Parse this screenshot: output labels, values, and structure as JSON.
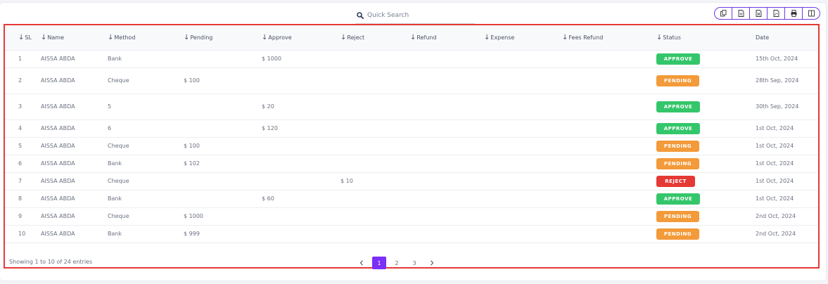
{
  "search": {
    "placeholder": "Quick Search"
  },
  "toolbar": {
    "buttons": [
      "copy-icon",
      "csv-icon",
      "excel-icon",
      "pdf-icon",
      "print-icon",
      "columns-icon"
    ]
  },
  "table": {
    "headers": {
      "sl": "SL",
      "name": "Name",
      "method": "Method",
      "pending": "Pending",
      "approve": "Approve",
      "reject": "Reject",
      "refund": "Refund",
      "expense": "Expense",
      "fees_refund": "Fees Refund",
      "status": "Status",
      "date": "Date"
    },
    "rows": [
      {
        "sl": "1",
        "name": "AISSA ABDA",
        "method": "Bank",
        "pending": "",
        "approve": "$ 1000",
        "reject": "",
        "refund": "",
        "expense": "",
        "fees_refund": "",
        "status": "APPROVE",
        "date": "15th Oct, 2024"
      },
      {
        "sl": "2",
        "name": "AISSA ABDA",
        "method": "Cheque",
        "pending": "$ 100",
        "approve": "",
        "reject": "",
        "refund": "",
        "expense": "",
        "fees_refund": "",
        "status": "PENDING",
        "date": "28th Sep, 2024"
      },
      {
        "sl": "3",
        "name": "AISSA ABDA",
        "method": "5",
        "pending": "",
        "approve": "$ 20",
        "reject": "",
        "refund": "",
        "expense": "",
        "fees_refund": "",
        "status": "APPROVE",
        "date": "30th Sep, 2024"
      },
      {
        "sl": "4",
        "name": "AISSA ABDA",
        "method": "6",
        "pending": "",
        "approve": "$ 120",
        "reject": "",
        "refund": "",
        "expense": "",
        "fees_refund": "",
        "status": "APPROVE",
        "date": "1st Oct, 2024"
      },
      {
        "sl": "5",
        "name": "AISSA ABDA",
        "method": "Cheque",
        "pending": "$ 100",
        "approve": "",
        "reject": "",
        "refund": "",
        "expense": "",
        "fees_refund": "",
        "status": "PENDING",
        "date": "1st Oct, 2024"
      },
      {
        "sl": "6",
        "name": "AISSA ABDA",
        "method": "Bank",
        "pending": "$ 102",
        "approve": "",
        "reject": "",
        "refund": "",
        "expense": "",
        "fees_refund": "",
        "status": "PENDING",
        "date": "1st Oct, 2024"
      },
      {
        "sl": "7",
        "name": "AISSA ABDA",
        "method": "Cheque",
        "pending": "",
        "approve": "",
        "reject": "$ 10",
        "refund": "",
        "expense": "",
        "fees_refund": "",
        "status": "REJECT",
        "date": "1st Oct, 2024"
      },
      {
        "sl": "8",
        "name": "AISSA ABDA",
        "method": "Bank",
        "pending": "",
        "approve": "$ 60",
        "reject": "",
        "refund": "",
        "expense": "",
        "fees_refund": "",
        "status": "APPROVE",
        "date": "1st Oct, 2024"
      },
      {
        "sl": "9",
        "name": "AISSA ABDA",
        "method": "Cheque",
        "pending": "$ 1000",
        "approve": "",
        "reject": "",
        "refund": "",
        "expense": "",
        "fees_refund": "",
        "status": "PENDING",
        "date": "2nd Oct, 2024"
      },
      {
        "sl": "10",
        "name": "AISSA ABDA",
        "method": "Bank",
        "pending": "$ 999",
        "approve": "",
        "reject": "",
        "refund": "",
        "expense": "",
        "fees_refund": "",
        "status": "PENDING",
        "date": "2nd Oct, 2024"
      }
    ]
  },
  "footer": {
    "entries_text": "Showing 1 to 10 of 24 entries",
    "pages": [
      "1",
      "2",
      "3"
    ],
    "active_page": "1"
  },
  "colors": {
    "approve": "#34c66a",
    "pending": "#f39a3a",
    "reject": "#e53935",
    "accent": "#7b2ff7",
    "highlight_frame": "#e53935"
  }
}
